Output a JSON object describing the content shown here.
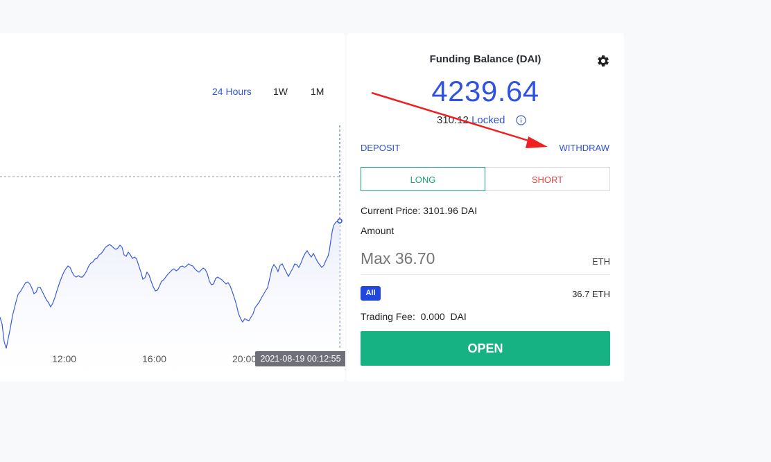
{
  "chart": {
    "timeframes": [
      {
        "label": "24 Hours",
        "active": true
      },
      {
        "label": "1W",
        "active": false
      },
      {
        "label": "1M",
        "active": false
      }
    ],
    "x_ticks": [
      "12:00",
      "16:00",
      "20:00"
    ],
    "tooltip": "2021-08-19 00:12:55",
    "line_color": "#3a5bdc"
  },
  "trade": {
    "title": "Funding Balance (DAI)",
    "balance": "4239.64",
    "locked_amount": "310.12",
    "locked_word": "Locked",
    "deposit_label": "DEPOSIT",
    "withdraw_label": "WITHDRAW",
    "long_label": "LONG",
    "short_label": "SHORT",
    "current_price": "Current Price: 3101.96 DAI",
    "amount_label": "Amount",
    "amount_placeholder": "Max 36.70",
    "amount_unit": "ETH",
    "all_label": "All",
    "max_eth": "36.7 ETH",
    "trading_fee": "Trading Fee:  0.000  DAI",
    "open_label": "OPEN"
  },
  "colors": {
    "accent_blue": "#2f52e0",
    "long_green": "#1aa37a",
    "short_red": "#f04343",
    "open_green": "#17b283",
    "annotation_red": "#f02020"
  },
  "icons": [
    "gear-icon",
    "info-icon",
    "annotation-arrow"
  ]
}
